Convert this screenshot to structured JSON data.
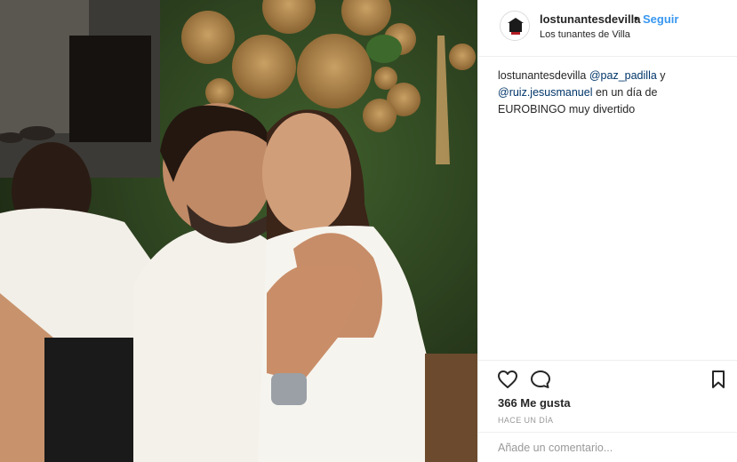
{
  "photo": {
    "alt": ""
  },
  "header": {
    "username": "lostunantesdevilla",
    "separator": "•",
    "follow_label": "Seguir",
    "location": "Los tunantes de Villa"
  },
  "caption": {
    "username": "lostunantesdevilla",
    "mention_1": "@paz_padilla",
    "connector": " y ",
    "mention_2": "@ruiz.jesusmanuel",
    "text": " en un día de EUROBINGO muy divertido"
  },
  "actions": {
    "likes": "366 Me gusta",
    "timestamp": "HACE UN DÍA",
    "comment_placeholder": "Añade un comentario..."
  },
  "icons": {
    "like": "heart-icon",
    "comment": "comment-icon",
    "save": "bookmark-icon"
  },
  "colors": {
    "link": "#3897f0",
    "mention": "#003569",
    "muted": "#999999",
    "wall": "#2f4a22"
  }
}
